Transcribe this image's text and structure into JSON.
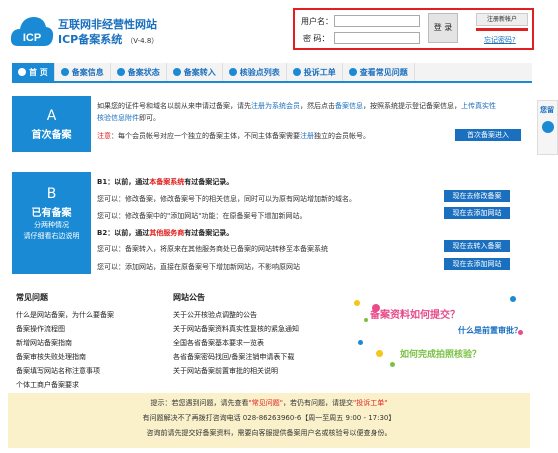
{
  "header": {
    "logo_text": "ICP",
    "title_line1": "互联网非经营性网站",
    "title_line2": "ICP备案系统",
    "version": "（V-4.8）"
  },
  "login": {
    "username_label": "用户名：",
    "password_label": "密  码：",
    "login_button": "登 录",
    "register_button": "注册新帐户",
    "forgot_link": "忘记密码?"
  },
  "nav": {
    "tabs": [
      {
        "label": "首 页"
      },
      {
        "label": "备案信息"
      },
      {
        "label": "备案状态"
      },
      {
        "label": "备案转入"
      },
      {
        "label": "核验点列表"
      },
      {
        "label": "投诉工单"
      },
      {
        "label": "查看常见问题"
      }
    ]
  },
  "sectionA": {
    "letter": "A",
    "title": "首次备案",
    "line1_a": "如果您的证件号和域名以前从来申请过备案，请先",
    "line1_link1": "注册为系统会员",
    "line1_b": "，然后点击",
    "line1_link2": "备案信息",
    "line1_c": "，按照系统提示登记备案信息，",
    "line1_link3": "上传真实性",
    "line2_link": "核验信息附件",
    "line2_b": "即可。",
    "note_label": "注意",
    "note_text_a": "：每个会员帐号对应一个独立的备案主体，不同主体备案需要",
    "note_link": "注册",
    "note_text_b": "独立的会员帐号。",
    "button": "首次备案进入"
  },
  "sectionB": {
    "letter": "B",
    "title": "已有备案",
    "sub1": "分两种情况",
    "sub2": "请仔细看右边说明",
    "b1_prefix": "B1：以前，通过",
    "b1_red": "本备案系统",
    "b1_suffix": "有过备案记录。",
    "b1_line1": "您可以：修改备案，修改备案号下的相关信息，同时可以为原有网站增加新的域名。",
    "b1_line2": "您可以：修改备案中的\"添加网站\"功能：在原备案号下增加新网站。",
    "b2_prefix": "B2：以前，通过",
    "b2_red": "其他服务商",
    "b2_suffix": "有过备案记录。",
    "b2_line1": "您可以：备案转入，将原来在其他服务商处已备案的网站转移至本备案系统",
    "b2_line2": "您可以：添加网站，直接在原备案号下增加新网站，不影响原网站",
    "btn1": "现在去修改备案",
    "btn2": "现在去添加网站",
    "btn3": "现在去转入备案",
    "btn4": "现在去添加网站"
  },
  "faq": {
    "heading": "常见问题",
    "items": [
      "什么是网站备案，为什么要备案",
      "备案操作流程图",
      "新增网站备案指南",
      "备案审核失败处理指南",
      "备案填写网站名称注意事项",
      "个体工商户备案要求"
    ]
  },
  "notice": {
    "heading": "网站公告",
    "items": [
      "关于公开核验点调整的公告",
      "关于网站备案资料真实性复核的紧急通知",
      "全国各省备案基本要求一览表",
      "各省备案密码找回/备案注销申请表下载",
      "关于网站备案前置审批的相关说明"
    ]
  },
  "promo": {
    "q1": "备案资料如何提交？",
    "q2": "什么是前置审批？",
    "q3": "如何完成拍照核验？"
  },
  "side": {
    "label": "您留"
  },
  "footer": {
    "line1_a": "提示：若您遇到问题，请先查看",
    "line1_red1": "\"常见问题\"",
    "line1_b": "，若仍有问题，请提交",
    "line1_red2": "\"投诉工单\"",
    "line2": "有问题解决不了再拨打咨询电话 028-86263960-6【周一至周五 9:00 - 17:30】",
    "line3": "咨询前请先提交好备案资料，需要向客服提供备案用户名或核验号以便查身份。"
  },
  "colors": {
    "accent_blue": "#1a8ad4",
    "link_blue": "#1a6fbe",
    "alert_red": "#e02020",
    "footer_bg": "#faf1cb"
  }
}
